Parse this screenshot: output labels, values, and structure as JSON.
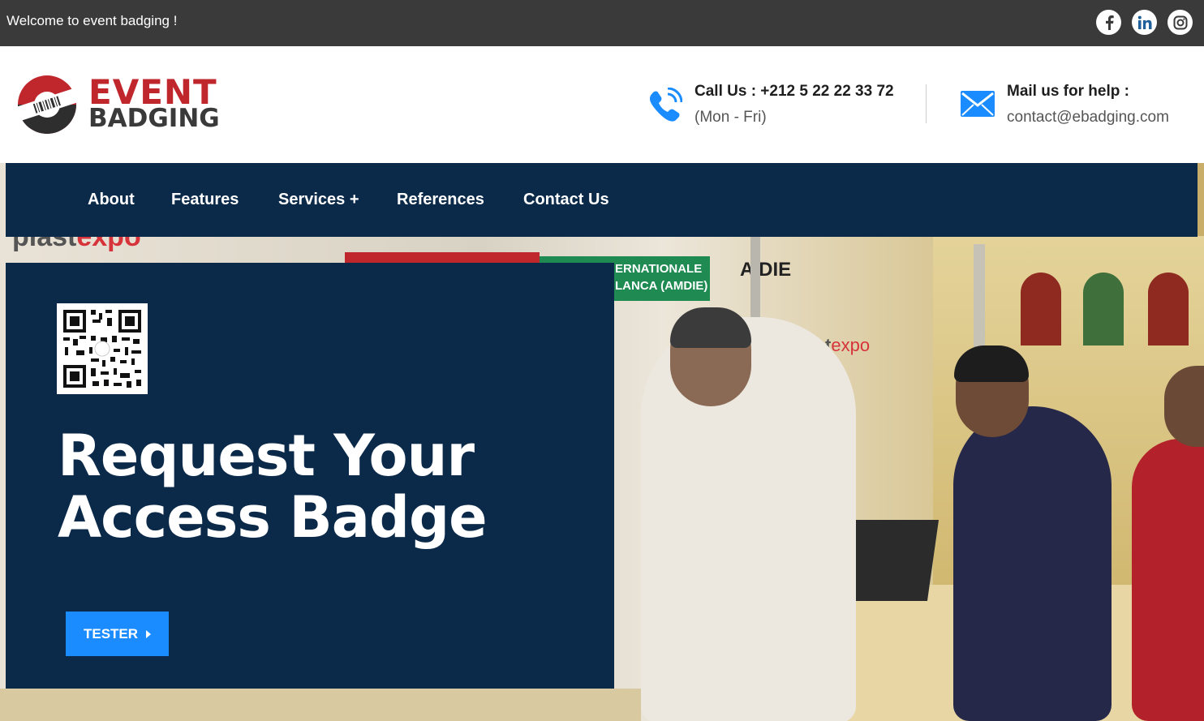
{
  "topbar": {
    "welcome": "Welcome to event badging !",
    "social": [
      {
        "name": "facebook-icon",
        "glyph": "f"
      },
      {
        "name": "linkedin-icon",
        "glyph": "in"
      },
      {
        "name": "instagram-icon",
        "glyph": "ig"
      }
    ]
  },
  "header": {
    "logo_line1": "EVENT",
    "logo_line2": "BADGING",
    "call_title": "Call Us : +212 5 22 22 33 72",
    "call_hours": "(Mon - Fri)",
    "mail_title": "Mail us for help :",
    "mail_address": "contact@ebadging.com"
  },
  "nav": {
    "items": [
      "About",
      "Features",
      "Services +",
      "References",
      "Contact Us"
    ]
  },
  "hero": {
    "headline_line1": "Request Your",
    "headline_line2": "Access Badge",
    "cta_label": "TESTER",
    "photo_text": {
      "plastexpo_a": "plast",
      "plastexpo_b": "expo",
      "banner": "ERNATIONALE LANCA (AMDIE)",
      "aidie": "A  DIE"
    }
  },
  "colors": {
    "topbar_bg": "#3a3a3a",
    "navy": "#0b2a4a",
    "brand_red": "#c0272d",
    "accent_blue": "#1a8cff",
    "icon_blue": "#1a8cff"
  }
}
